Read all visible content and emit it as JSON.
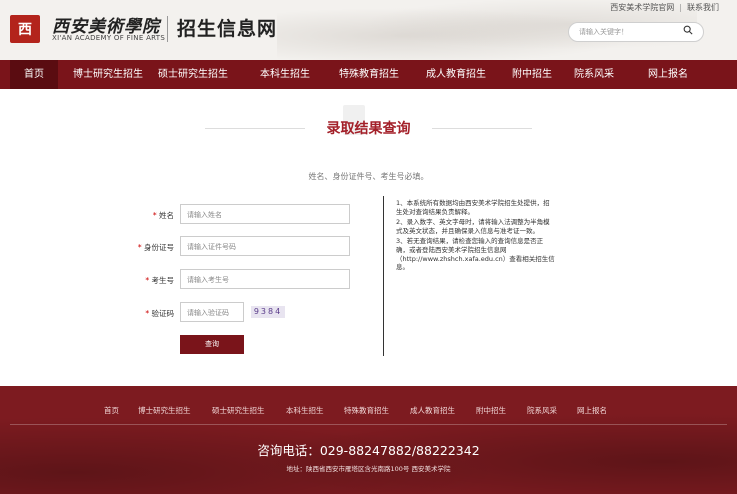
{
  "header": {
    "logo_seal": "西",
    "logo_cn": "西安美術學院",
    "logo_en": "XI'AN ACADEMY OF FINE ARTS",
    "site_title": "招生信息网",
    "top_links": [
      "西安美术学院官网",
      "联系我们"
    ],
    "search_placeholder": "请输入关键字！",
    "search_icon": "search-icon"
  },
  "nav": {
    "items": [
      "首页",
      "博士研究生招生",
      "硕士研究生招生",
      "本科生招生",
      "特殊教育招生",
      "成人教育招生",
      "附中招生",
      "院系风采",
      "网上报名"
    ],
    "active_index": 0
  },
  "main": {
    "title": "录取结果查询",
    "notice": "姓名、身份证件号、考生号必填。",
    "form": {
      "rows": [
        {
          "label": "姓名",
          "placeholder": "请输入姓名"
        },
        {
          "label": "身份证号",
          "placeholder": "请输入证件号码"
        },
        {
          "label": "考生号",
          "placeholder": "请输入考生号"
        },
        {
          "label": "验证码",
          "placeholder": "请输入验证码"
        }
      ],
      "required_mark": "*",
      "captcha": "9384",
      "submit": "查询"
    },
    "info": [
      "1、本系统所有数据均由西安美术学院招生处提供，招生处对查询结果负责解释。",
      "2、录入数字、英文字母时，请将输入法调整为半角模式及英文状态，并且确保录入信息与准考证一致。",
      "3、若无查询结果，请检查您输入的查询信息是否正确，或者登陆西安美术学院招生信息网（http://www.zhshch.xafa.edu.cn）查看相关招生信息。"
    ]
  },
  "footer": {
    "nav": [
      "首页",
      "博士研究生招生",
      "硕士研究生招生",
      "本科生招生",
      "特殊教育招生",
      "成人教育招生",
      "附中招生",
      "院系风采",
      "网上报名"
    ],
    "phone": "咨询电话：029-88247882/88222342",
    "address": "地址：陕西省西安市雁塔区含光南路100号 西安美术学院"
  },
  "colors": {
    "brand": "#7a141a",
    "title": "#a32029",
    "footer": "#7d1b20"
  }
}
